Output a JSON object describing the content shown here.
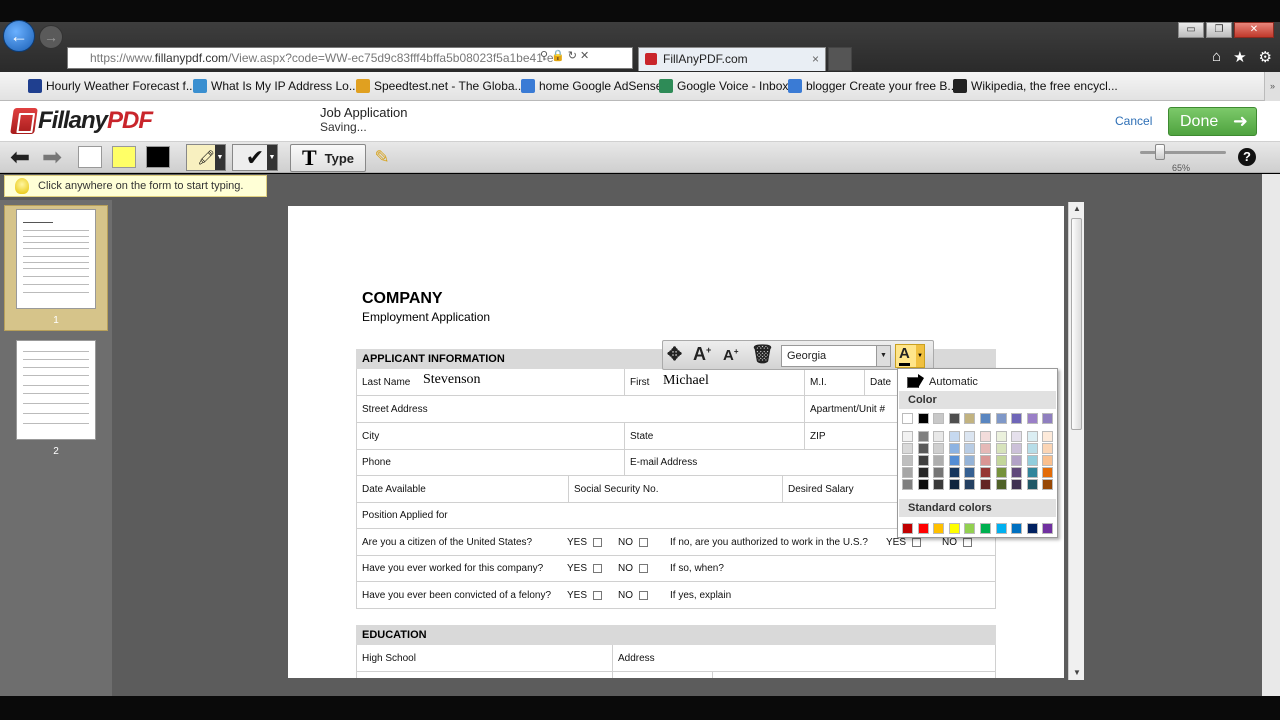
{
  "browser": {
    "url_prefix": "https://www.",
    "url_domain": "fillanypdf.com",
    "url_rest": "/View.aspx?code=WW-ec75d9c83fff4bffa5b08023f5a1be41-e",
    "tab_title": "FillAnyPDF.com",
    "tab_close": "×",
    "window_controls": [
      "▭",
      "❐",
      "✕"
    ],
    "favorites": [
      {
        "label": "Hourly Weather Forecast f...",
        "icon": "weather-icon",
        "color": "#1f3f8f"
      },
      {
        "label": "What Is My IP Address Lo...",
        "icon": "globe-icon",
        "color": "#3a8fd0"
      },
      {
        "label": "Speedtest.net - The Globa...",
        "icon": "speedtest-icon",
        "color": "#e0a020"
      },
      {
        "label": "home Google AdSense",
        "icon": "google-icon",
        "color": "#3a7bd5"
      },
      {
        "label": "Google Voice - Inbox",
        "icon": "google-voice-icon",
        "color": "#2e8b57"
      },
      {
        "label": "blogger Create your free B...",
        "icon": "google-icon",
        "color": "#3a7bd5"
      },
      {
        "label": "Wikipedia, the free encycl...",
        "icon": "wikipedia-icon",
        "color": "#222222"
      }
    ]
  },
  "app": {
    "logo_text_1": "Fill",
    "logo_text_2": "any",
    "logo_text_3": "PDF",
    "doc_title": "Job Application",
    "doc_status": "Saving...",
    "cancel_label": "Cancel",
    "done_label": "Done",
    "type_tool_label": "Type",
    "type_tool_glyph": "T",
    "zoom_label": "65%",
    "zoom_level": 0.65,
    "help_glyph": "?",
    "hint_text": "Click anywhere on the form to start typing.",
    "pages": [
      "1",
      "2"
    ],
    "accent_color": "#5cb04a",
    "brand_red": "#c9252b"
  },
  "form": {
    "company": "COMPANY",
    "subtitle": "Employment Application",
    "section_applicant": "APPLICANT INFORMATION",
    "section_education": "EDUCATION",
    "last_name_label": "Last Name",
    "last_name_value": "Stevenson",
    "first_label": "First",
    "first_value": "Michael",
    "mi_label": "M.I.",
    "date_label": "Date",
    "street_label": "Street Address",
    "apt_label": "Apartment/Unit #",
    "city_label": "City",
    "state_label": "State",
    "zip_label": "ZIP",
    "phone_label": "Phone",
    "email_label": "E-mail Address",
    "date_available_label": "Date Available",
    "ssn_label": "Social Security No.",
    "salary_label": "Desired Salary",
    "position_label": "Position Applied for",
    "citizen_q": "Are you a citizen of the United States?",
    "authorized_q": "If no, are you authorized to work in the U.S.?",
    "worked_q": "Have you ever worked for this company?",
    "ifso_q": "If so, when?",
    "convicted_q": "Have you ever been convicted of a felony?",
    "ifyes_q": "If yes, explain",
    "yes": "YES",
    "no": "NO",
    "high_school_label": "High School",
    "address_label": "Address"
  },
  "text_toolbar": {
    "font": "Georgia",
    "color_glyph": "A",
    "automatic_label": "Automatic",
    "color_header": "Color",
    "standard_header": "Standard colors",
    "theme_top": [
      "#ffffff",
      "#000000",
      "#c8c8c8",
      "#4f4f4f",
      "#c2b380",
      "#5a86c0",
      "#7f98c8",
      "#6f66b8",
      "#9a7fc7",
      "#8f7fbf"
    ],
    "theme_cols": [
      [
        "#f2f2f2",
        "#d9d9d9",
        "#bfbfbf",
        "#a6a6a6",
        "#7f7f7f"
      ],
      [
        "#7f7f7f",
        "#595959",
        "#3f3f3f",
        "#262626",
        "#0d0d0d"
      ],
      [
        "#e8e8e8",
        "#cfcfcf",
        "#aeaeae",
        "#757575",
        "#3a3a3a"
      ],
      [
        "#c6d9f0",
        "#8db3e2",
        "#548dd4",
        "#17365d",
        "#0f243e"
      ],
      [
        "#dbe5f1",
        "#b8cce4",
        "#95b3d7",
        "#366092",
        "#244061"
      ],
      [
        "#f2dcdb",
        "#e5b9b7",
        "#d99694",
        "#953734",
        "#632423"
      ],
      [
        "#ebf1dd",
        "#d7e3bc",
        "#c3d69b",
        "#76923c",
        "#4f6128"
      ],
      [
        "#e5e0ec",
        "#ccc1d9",
        "#b2a2c7",
        "#5f497a",
        "#3f3151"
      ],
      [
        "#dbeef3",
        "#b7dde8",
        "#92cddc",
        "#31859b",
        "#205867"
      ],
      [
        "#fdeada",
        "#fbd5b5",
        "#fac08f",
        "#e36c09",
        "#974806"
      ]
    ],
    "standard": [
      "#c00000",
      "#ff0000",
      "#ffc000",
      "#ffff00",
      "#92d050",
      "#00b050",
      "#00b0f0",
      "#0070c0",
      "#002060",
      "#7030a0"
    ]
  }
}
